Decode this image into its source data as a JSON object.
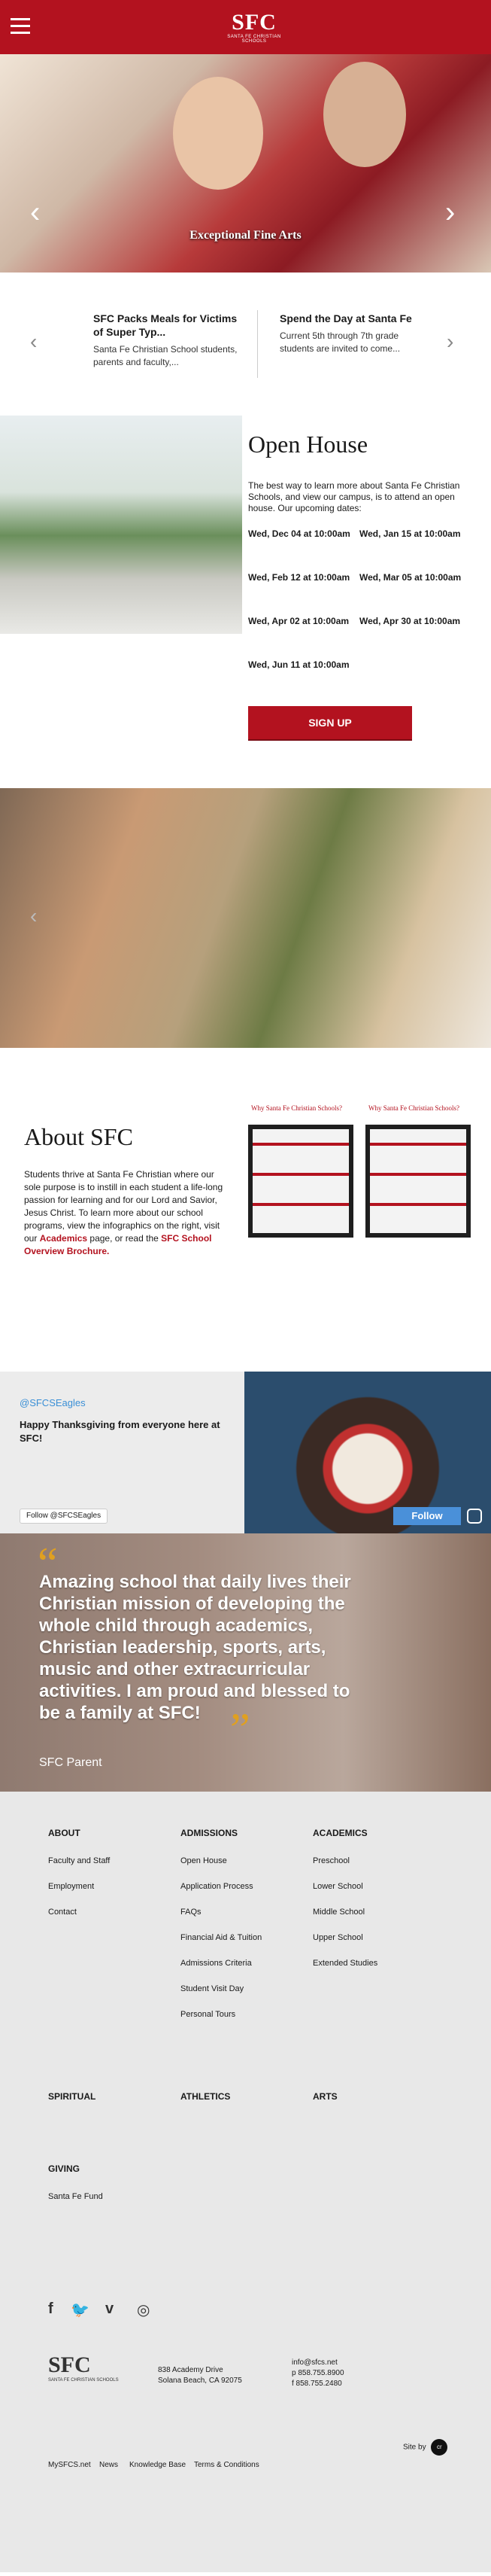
{
  "brand": {
    "logo_text": "SFC",
    "logo_sub": "SANTA FE CHRISTIAN SCHOOLS",
    "red": "#b3121f",
    "gold": "#e0a020"
  },
  "hero": {
    "caption": "Exceptional Fine Arts",
    "prev_icon": "‹",
    "next_icon": "›"
  },
  "news": {
    "items": [
      {
        "title": "SFC Packs Meals for Victims of Super Typ...",
        "desc": "Santa Fe Christian School students, parents and faculty,..."
      },
      {
        "title": "Spend the Day at Santa Fe",
        "desc": "Current 5th through 7th grade students are invited to come..."
      }
    ]
  },
  "open_house": {
    "title": "Open House",
    "intro": "The best way to learn more about Santa Fe Christian Schools, and view our campus, is to attend an open house. Our upcoming dates:",
    "dates": [
      "Wed, Dec 04 at 10:00am",
      "Wed, Jan 15 at 10:00am",
      "Wed, Feb 12 at 10:00am",
      "Wed, Mar 05 at 10:00am",
      "Wed, Apr 02 at 10:00am",
      "Wed, Apr 30 at 10:00am",
      "Wed, Jun 11 at 10:00am"
    ],
    "signup": "SIGN UP"
  },
  "about": {
    "title": "About SFC",
    "text_1": "Students thrive at Santa Fe Christian where our sole purpose is to instill in each student a life-long passion for learning and for our Lord and Savior, Jesus Christ. To learn more about our school programs, view the infographics on the right, visit our ",
    "link_1": "Academics",
    "text_2": " page, or read the ",
    "link_2": "SFC School Overview Brochure.",
    "infographics": [
      "Why Santa Fe Christian Schools?",
      "Why Santa Fe Christian Schools?"
    ]
  },
  "social": {
    "handle": "@SFCSEagles",
    "tweet": "Happy Thanksgiving from everyone here at SFC!",
    "follow_twitter": "Follow @SFCSEagles",
    "follow_instagram": "Follow"
  },
  "testimonial": {
    "quote": "Amazing school that daily lives their Christian mission of developing the whole child through academics, Christian leadership, sports, arts, music and other extracurricular activities. I am proud and blessed to be a family at SFC!",
    "author": "SFC Parent",
    "open_mark": "“",
    "close_mark": "”"
  },
  "footer": {
    "about": {
      "heading": "ABOUT",
      "items": [
        "Faculty and Staff",
        "Employment",
        "Contact"
      ]
    },
    "admissions": {
      "heading": "ADMISSIONS",
      "items": [
        "Open House",
        "Application Process",
        "FAQs",
        "Financial Aid & Tuition",
        "Admissions Criteria",
        "Student Visit Day",
        "Personal Tours"
      ]
    },
    "academics": {
      "heading": "ACADEMICS",
      "items": [
        "Preschool",
        "Lower School",
        "Middle School",
        "Upper School",
        "Extended Studies"
      ]
    },
    "spiritual": "SPIRITUAL",
    "athletics": "ATHLETICS",
    "arts": "ARTS",
    "giving": {
      "heading": "GIVING",
      "items": [
        "Santa Fe Fund"
      ]
    },
    "social_icons": [
      "f",
      "🐦",
      "v",
      "◎"
    ],
    "address_1": "838 Academy Drive",
    "address_2": "Solana Beach, CA 92075",
    "email": "info@sfcs.net",
    "phone": "p 858.755.8900",
    "fax": "f 858.755.2480",
    "site_by": "Site by",
    "site_by_badge": "cr",
    "bottom_links": [
      "MySFCS.net",
      "News",
      "Knowledge Base",
      "Terms & Conditions"
    ]
  }
}
